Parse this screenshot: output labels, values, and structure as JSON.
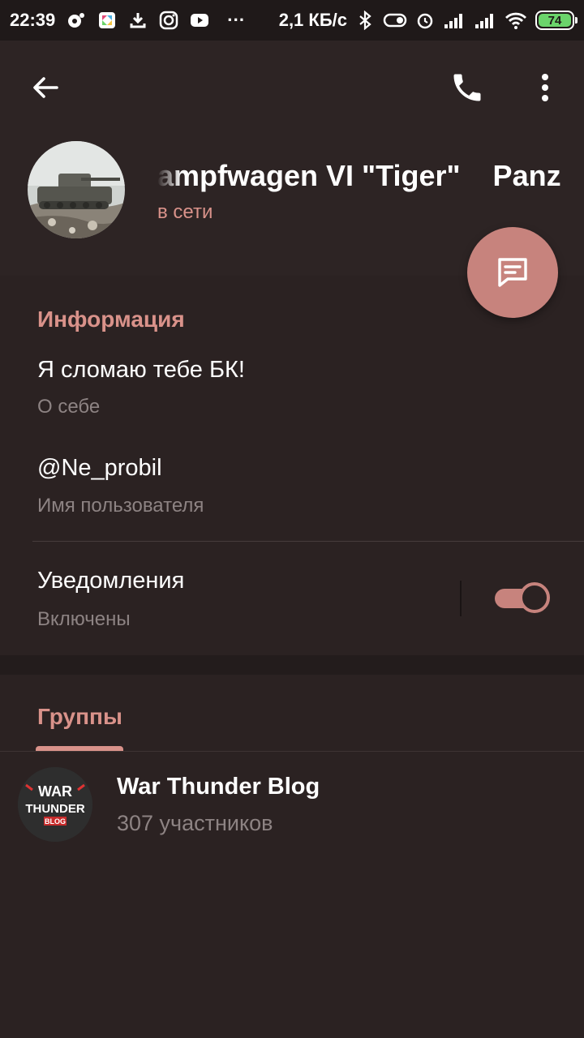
{
  "statusbar": {
    "time": "22:39",
    "dots": "···",
    "net_speed": "2,1 КБ/с",
    "battery": "74"
  },
  "header": {
    "title": "ampfwagen VI \"Tiger\"    Panz",
    "status": "в сети"
  },
  "info": {
    "section_title": "Информация",
    "bio_value": "Я сломаю тебе БК!",
    "bio_label": "О себе",
    "username_value": "@Ne_probil",
    "username_label": "Имя пользователя",
    "notifications_value": "Уведомления",
    "notifications_label": "Включены",
    "notifications_enabled": true
  },
  "groups": {
    "tab_label": "Группы",
    "items": [
      {
        "title": "War Thunder Blog",
        "subtitle": "307 участников",
        "logo_text_top": "WAR",
        "logo_text_mid": "THUNDER",
        "logo_text_bot": "BLOG"
      }
    ]
  },
  "colors": {
    "accent": "#d9928a",
    "fab": "#c7837d",
    "background": "#2b2222"
  },
  "icons": {
    "back": "arrow-left-icon",
    "call": "phone-icon",
    "more": "more-vertical-icon",
    "fab": "message-icon"
  }
}
